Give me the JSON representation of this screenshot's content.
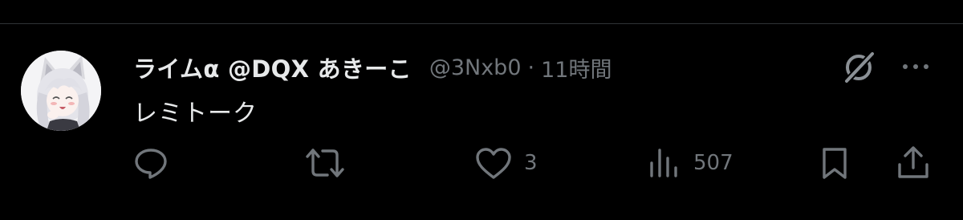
{
  "tweet": {
    "display_name": "ライムα @DQX あきーこ",
    "handle": "@3Nxb0",
    "separator": "·",
    "time": "11時間",
    "text": "レミトーク"
  },
  "actions": {
    "like_count": "3",
    "view_count": "507"
  },
  "icons": {
    "reply": "reply-icon",
    "retweet": "retweet-icon",
    "like": "heart-icon",
    "views": "analytics-icon",
    "bookmark": "bookmark-icon",
    "share": "share-icon",
    "grok": "grok-icon",
    "more": "more-icon"
  },
  "colors": {
    "background": "#000000",
    "primary_text": "#e7e9ea",
    "secondary_text": "#71767b",
    "divider": "#2f3336"
  }
}
